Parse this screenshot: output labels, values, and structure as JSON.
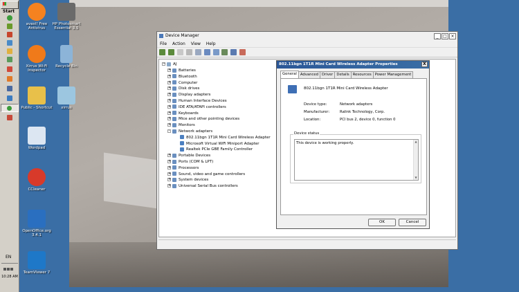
{
  "taskbar": {
    "start_label": "Start",
    "tray_lang": "EN",
    "clock": "10:28 AM"
  },
  "desktop_icons": [
    {
      "label": "avast! Free Antivirus",
      "color": "#f58220"
    },
    {
      "label": "HP Photosmart Essential 3.5",
      "color": "#6a6a6a"
    },
    {
      "label": "Xirrus Wi-Fi Inspector",
      "color": "#f07a1a"
    },
    {
      "label": "Recycle Bin",
      "color": "#8cb4d8"
    },
    {
      "label": "Public - Shortcut",
      "color": "#e8c04a"
    },
    {
      "label": "xirrus",
      "color": "#9cc6e0"
    },
    {
      "label": "Wordpad",
      "color": "#dce6f2"
    },
    {
      "label": "CCleaner",
      "color": "#d83a2a"
    },
    {
      "label": "OpenOffice.org 3.4.1",
      "color": "#2a6fc0"
    },
    {
      "label": "TeamViewer 7",
      "color": "#1e78c8"
    }
  ],
  "device_manager": {
    "title": "Device Manager",
    "menu": [
      "File",
      "Action",
      "View",
      "Help"
    ],
    "tree": {
      "root": "AJ",
      "items": [
        {
          "label": "Batteries",
          "expander": "+"
        },
        {
          "label": "Bluetooth",
          "expander": "+"
        },
        {
          "label": "Computer",
          "expander": "+"
        },
        {
          "label": "Disk drives",
          "expander": "+"
        },
        {
          "label": "Display adapters",
          "expander": "+"
        },
        {
          "label": "Human Interface Devices",
          "expander": "+"
        },
        {
          "label": "IDE ATA/ATAPI controllers",
          "expander": "+"
        },
        {
          "label": "Keyboards",
          "expander": "+"
        },
        {
          "label": "Mice and other pointing devices",
          "expander": "+"
        },
        {
          "label": "Monitors",
          "expander": "+"
        },
        {
          "label": "Network adapters",
          "expander": "-"
        },
        {
          "label": "802.11bgn 1T1R Mini Card Wireless Adapter",
          "child": true
        },
        {
          "label": "Microsoft Virtual WiFi Miniport Adapter",
          "child": true
        },
        {
          "label": "Realtek PCIe GBE Family Controller",
          "child": true
        },
        {
          "label": "Portable Devices",
          "expander": "+"
        },
        {
          "label": "Ports (COM & LPT)",
          "expander": "+"
        },
        {
          "label": "Processors",
          "expander": "+"
        },
        {
          "label": "Sound, video and game controllers",
          "expander": "+"
        },
        {
          "label": "System devices",
          "expander": "+"
        },
        {
          "label": "Universal Serial Bus controllers",
          "expander": "+"
        }
      ]
    }
  },
  "properties": {
    "title": "802.11bgn 1T1R Mini Card Wireless Adapter Properties",
    "close_glyph": "X",
    "tabs": [
      "General",
      "Advanced",
      "Driver",
      "Details",
      "Resources",
      "Power Management"
    ],
    "active_tab": "General",
    "device_name": "802.11bgn 1T1R Mini Card Wireless Adapter",
    "props": [
      {
        "label": "Device type:",
        "value": "Network adapters"
      },
      {
        "label": "Manufacturer:",
        "value": "Ralink Technology, Corp."
      },
      {
        "label": "Location:",
        "value": "PCI bus 2, device 0, function 0"
      }
    ],
    "status_legend": "Device status",
    "status_text": "This device is working properly.",
    "ok_label": "OK",
    "cancel_label": "Cancel"
  }
}
